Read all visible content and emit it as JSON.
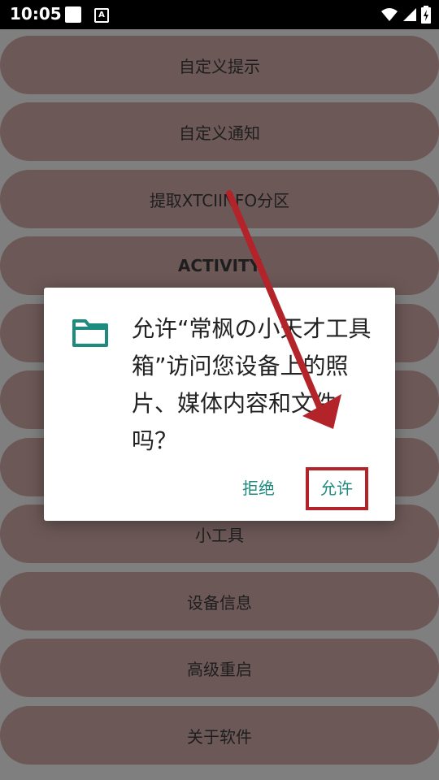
{
  "status_bar": {
    "time": "10:05",
    "a_badge": "A"
  },
  "menu": {
    "items": [
      {
        "label": "自定义提示"
      },
      {
        "label": "自定义通知"
      },
      {
        "label": "提取XTCIINFO分区"
      },
      {
        "label": "ACTIVITY"
      },
      {
        "label": ""
      },
      {
        "label": ""
      },
      {
        "label": ""
      },
      {
        "label": "小工具"
      },
      {
        "label": "设备信息"
      },
      {
        "label": "高级重启"
      },
      {
        "label": "关于软件"
      }
    ]
  },
  "dialog": {
    "message": "允许“常枫の小天才工具箱”访问您设备上的照片、媒体内容和文件吗？",
    "deny_label": "拒绝",
    "allow_label": "允许"
  },
  "colors": {
    "accent": "#1f8a7f",
    "button_bg": "#6c5857",
    "annotation_red": "#b2232a"
  },
  "icons": [
    "folder-icon",
    "wifi-icon",
    "signal-icon",
    "battery-icon"
  ]
}
